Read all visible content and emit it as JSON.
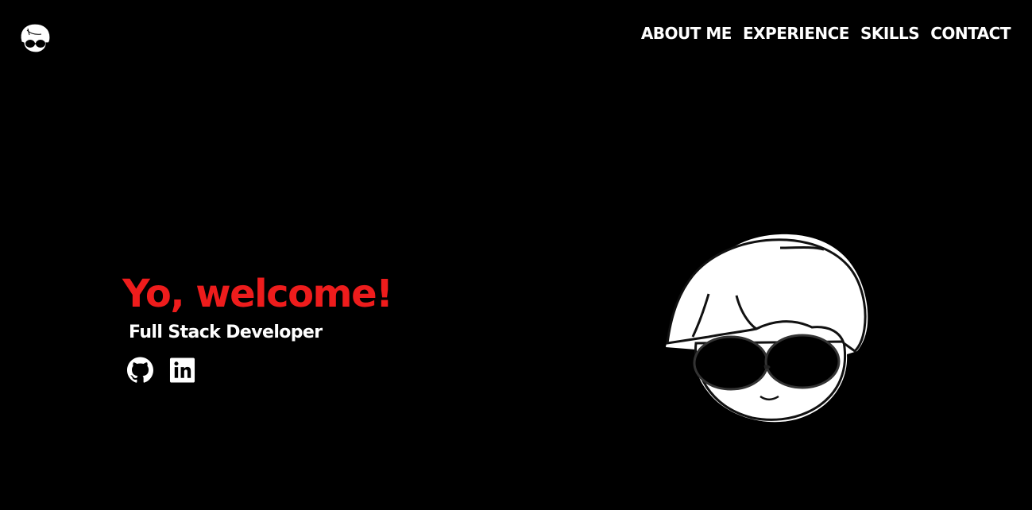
{
  "header": {
    "logo_icon": "avatar-logo-icon",
    "nav": [
      {
        "label": "ABOUT ME"
      },
      {
        "label": "EXPERIENCE"
      },
      {
        "label": "SKILLS"
      },
      {
        "label": "CONTACT"
      }
    ]
  },
  "hero": {
    "headline": "Yo, welcome!",
    "subtitle": "Full Stack Developer",
    "socials": [
      {
        "icon": "github-icon"
      },
      {
        "icon": "linkedin-icon"
      }
    ],
    "illustration": "cartoon-avatar-with-sunglasses"
  },
  "colors": {
    "background": "#000000",
    "accent": "#ee1c1c",
    "text": "#ffffff"
  }
}
